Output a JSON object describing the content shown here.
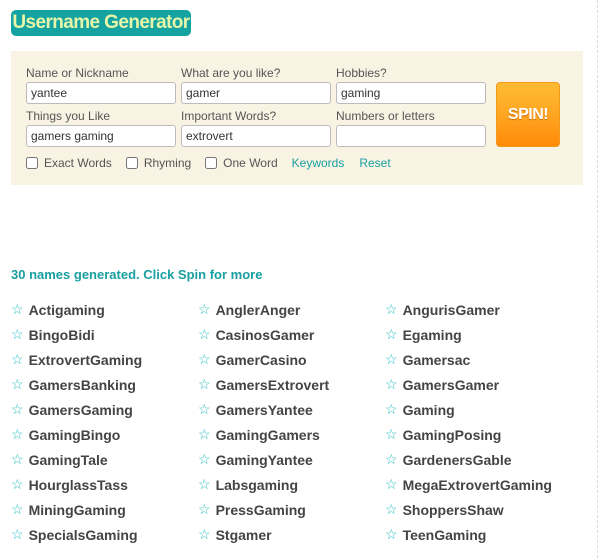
{
  "title": "Username Generator",
  "form": {
    "fields": [
      {
        "label": "Name or Nickname",
        "value": "yantee"
      },
      {
        "label": "What are you like?",
        "value": "gamer"
      },
      {
        "label": "Hobbies?",
        "value": "gaming"
      },
      {
        "label": "Things you Like",
        "value": "gamers gaming"
      },
      {
        "label": "Important Words?",
        "value": "extrovert"
      },
      {
        "label": "Numbers or letters",
        "value": ""
      }
    ],
    "spin_label": "SPIN!",
    "options": [
      {
        "label": "Exact Words",
        "checked": false
      },
      {
        "label": "Rhyming",
        "checked": false
      },
      {
        "label": "One Word",
        "checked": false
      }
    ],
    "keywords_label": "Keywords",
    "reset_label": "Reset"
  },
  "status": "30 names generated. Click Spin for more",
  "accent_color": "#14a3a0",
  "names": [
    "Actigaming",
    "AnglerAnger",
    "AngurisGamer",
    "BingoBidi",
    "CasinosGamer",
    "Egaming",
    "ExtrovertGaming",
    "GamerCasino",
    "Gamersac",
    "GamersBanking",
    "GamersExtrovert",
    "GamersGamer",
    "GamersGaming",
    "GamersYantee",
    "Gaming",
    "GamingBingo",
    "GamingGamers",
    "GamingPosing",
    "GamingTale",
    "GamingYantee",
    "GardenersGable",
    "HourglassTass",
    "Labsgaming",
    "MegaExtrovertGaming",
    "MiningGaming",
    "PressGaming",
    "ShoppersShaw",
    "SpecialsGaming",
    "Stgamer",
    "TeenGaming"
  ]
}
